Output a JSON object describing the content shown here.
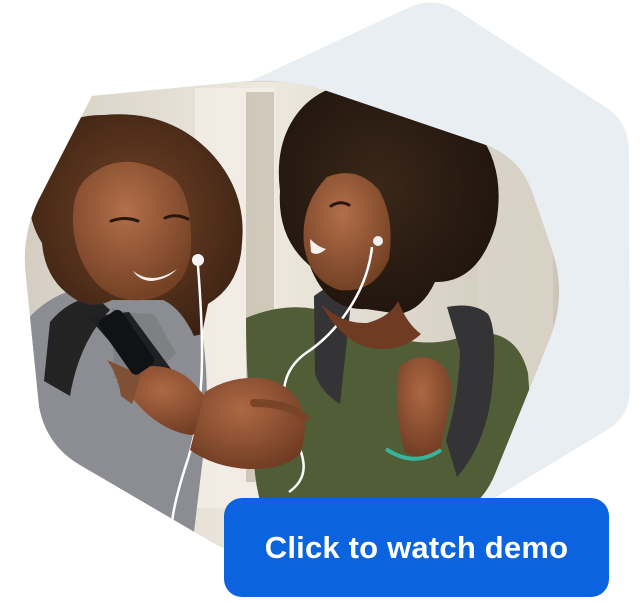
{
  "demo_card": {
    "button_label": "Click to watch demo",
    "colors": {
      "button_bg": "#0b63df",
      "button_text": "#ffffff",
      "background_hexagon": "#e9eef3",
      "page_bg": "#ffffff"
    },
    "icons": {
      "background_shape": "hexagon-shape",
      "photo": "people-listening-music-image"
    }
  }
}
